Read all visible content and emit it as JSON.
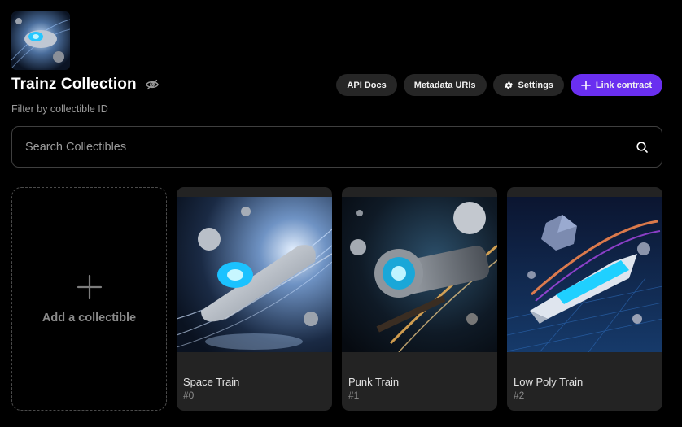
{
  "collection": {
    "title": "Trainz Collection",
    "logo_icon": "train-thumbnail",
    "hide_icon": "eye-slash-icon"
  },
  "toolbar": {
    "api_docs": "API Docs",
    "metadata_uris": "Metadata URIs",
    "settings": "Settings",
    "link_contract": "Link contract",
    "accent_color": "#6a2ff0"
  },
  "filter": {
    "label": "Filter by collectible ID",
    "placeholder": "Search Collectibles",
    "value": ""
  },
  "add_card": {
    "label": "Add a collectible"
  },
  "collectibles": [
    {
      "name": "Space Train",
      "id": "#0"
    },
    {
      "name": "Punk Train",
      "id": "#1"
    },
    {
      "name": "Low Poly Train",
      "id": "#2"
    }
  ]
}
